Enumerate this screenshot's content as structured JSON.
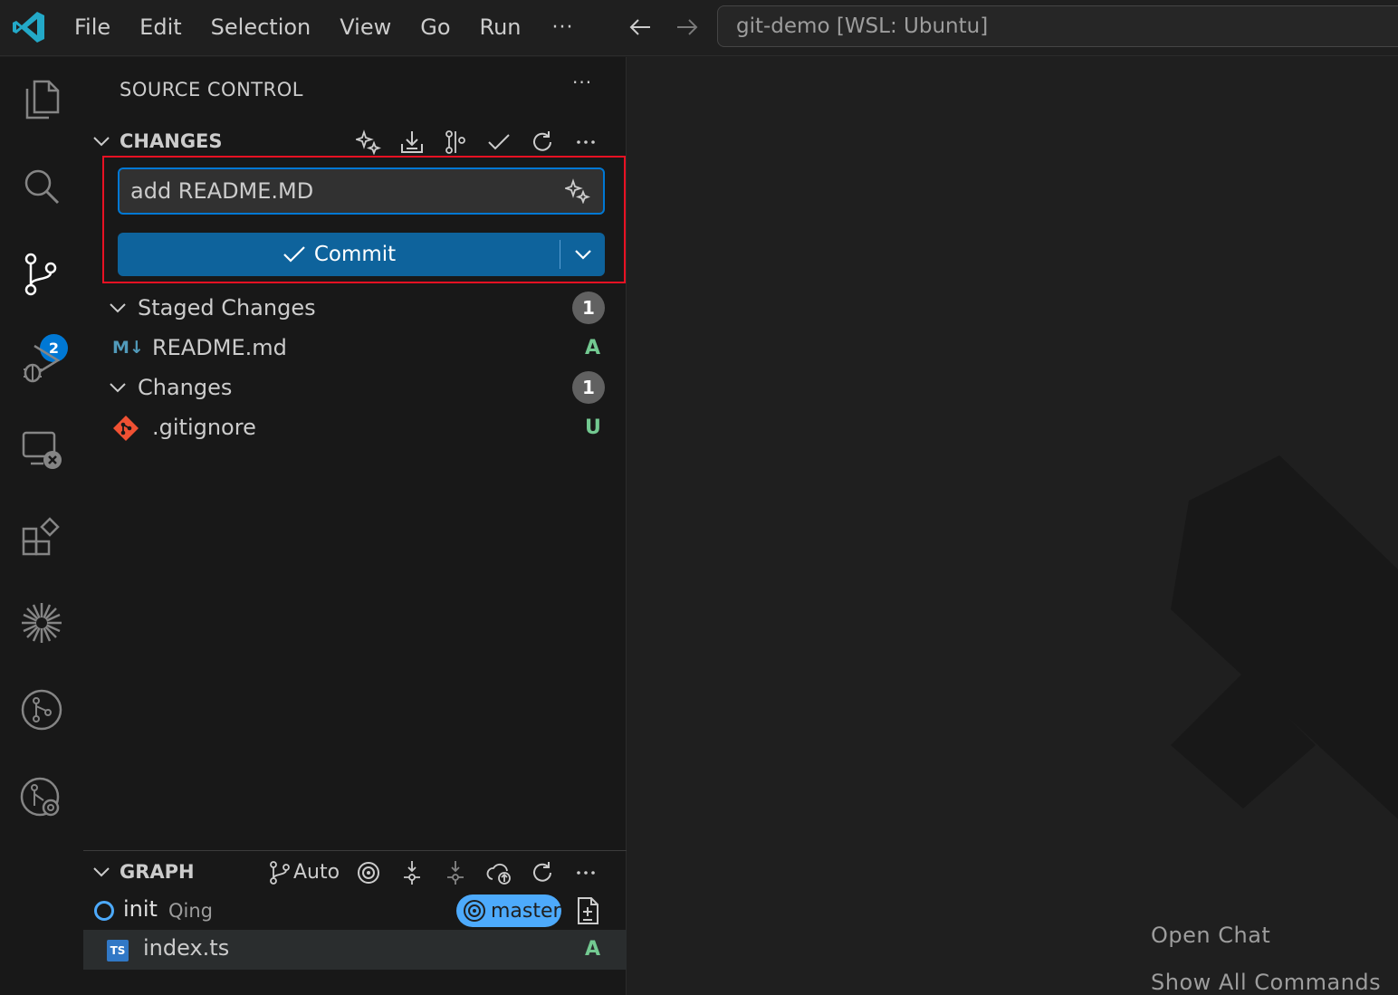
{
  "titlebar": {
    "menu": [
      "File",
      "Edit",
      "Selection",
      "View",
      "Go",
      "Run"
    ],
    "more": "···",
    "command_center": "git-demo [WSL: Ubuntu]"
  },
  "activity": {
    "scm_badge": "2"
  },
  "sidebar": {
    "title": "SOURCE CONTROL",
    "more": "···",
    "changes_section": {
      "title": "CHANGES",
      "commit_message": "add README.MD",
      "commit_label": "Commit",
      "staged": {
        "label": "Staged Changes",
        "count": "1",
        "files": [
          {
            "name": "README.md",
            "icon_text": "M↓",
            "status": "A"
          }
        ]
      },
      "changes": {
        "label": "Changes",
        "count": "1",
        "files": [
          {
            "name": ".gitignore",
            "status": "U"
          }
        ]
      }
    },
    "graph_section": {
      "title": "GRAPH",
      "auto_label": "Auto",
      "commit": {
        "message": "init",
        "author": "Qing",
        "branch": "master"
      },
      "file": {
        "name": "index.ts",
        "icon_text": "TS",
        "status": "A"
      }
    }
  },
  "editor": {
    "hints": [
      "Open Chat",
      "Show All Commands"
    ]
  },
  "colors": {
    "accent": "#0078d4",
    "commit_button": "#0e639c",
    "highlight": "#e81123",
    "added": "#73c991",
    "branch": "#4daafc"
  }
}
